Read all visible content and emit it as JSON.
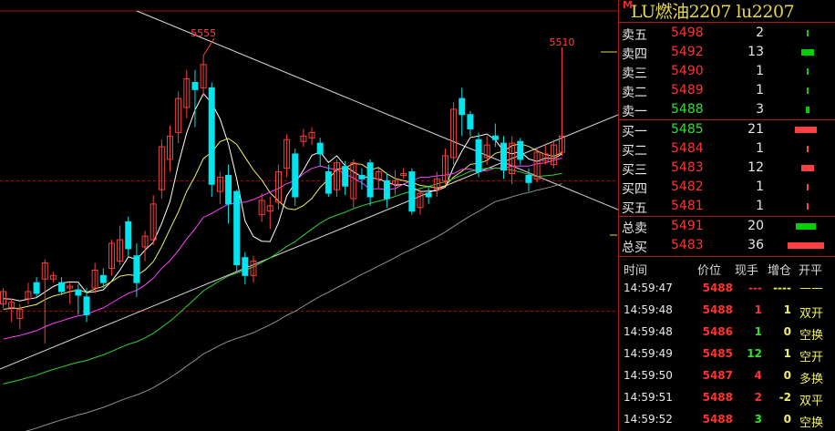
{
  "chart_data": {
    "type": "candlestick",
    "ylim": [
      5345,
      5580
    ],
    "reference_lines": [
      5485,
      5412
    ],
    "high_label": "5555",
    "high_marker_value": 5555,
    "last_label": "5510",
    "last_marker_value": 5510,
    "candles": [
      {
        "o": 5416,
        "c": 5423,
        "h": 5425,
        "l": 5414
      },
      {
        "o": 5414,
        "c": 5417,
        "h": 5419,
        "l": 5406
      },
      {
        "o": 5408,
        "c": 5413,
        "h": 5416,
        "l": 5402
      },
      {
        "o": 5419,
        "c": 5423,
        "h": 5428,
        "l": 5416
      },
      {
        "o": 5428,
        "c": 5422,
        "h": 5431,
        "l": 5420
      },
      {
        "o": 5430,
        "c": 5439,
        "h": 5441,
        "l": 5394
      },
      {
        "o": 5430,
        "c": 5432,
        "h": 5434,
        "l": 5428
      },
      {
        "o": 5428,
        "c": 5423,
        "h": 5431,
        "l": 5421
      },
      {
        "o": 5425,
        "c": 5426,
        "h": 5428,
        "l": 5416
      },
      {
        "o": 5424,
        "c": 5421,
        "h": 5427,
        "l": 5410
      },
      {
        "o": 5420,
        "c": 5410,
        "h": 5425,
        "l": 5406
      },
      {
        "o": 5425,
        "c": 5435,
        "h": 5439,
        "l": 5422
      },
      {
        "o": 5432,
        "c": 5428,
        "h": 5436,
        "l": 5425
      },
      {
        "o": 5436,
        "c": 5450,
        "h": 5452,
        "l": 5432
      },
      {
        "o": 5440,
        "c": 5452,
        "h": 5460,
        "l": 5438
      },
      {
        "o": 5462,
        "c": 5447,
        "h": 5465,
        "l": 5443
      },
      {
        "o": 5443,
        "c": 5428,
        "h": 5450,
        "l": 5420
      },
      {
        "o": 5448,
        "c": 5454,
        "h": 5457,
        "l": 5440
      },
      {
        "o": 5452,
        "c": 5472,
        "h": 5477,
        "l": 5449
      },
      {
        "o": 5480,
        "c": 5504,
        "h": 5508,
        "l": 5475
      },
      {
        "o": 5497,
        "c": 5510,
        "h": 5516,
        "l": 5490
      },
      {
        "o": 5512,
        "c": 5531,
        "h": 5535,
        "l": 5506
      },
      {
        "o": 5526,
        "c": 5542,
        "h": 5547,
        "l": 5520
      },
      {
        "o": 5540,
        "c": 5536,
        "h": 5547,
        "l": 5515
      },
      {
        "o": 5537,
        "c": 5550,
        "h": 5555,
        "l": 5532
      },
      {
        "o": 5537,
        "c": 5483,
        "h": 5540,
        "l": 5476
      },
      {
        "o": 5479,
        "c": 5487,
        "h": 5490,
        "l": 5472
      },
      {
        "o": 5488,
        "c": 5472,
        "h": 5494,
        "l": 5461
      },
      {
        "o": 5479,
        "c": 5438,
        "h": 5480,
        "l": 5434
      },
      {
        "o": 5442,
        "c": 5432,
        "h": 5445,
        "l": 5427
      },
      {
        "o": 5432,
        "c": 5440,
        "h": 5443,
        "l": 5428
      },
      {
        "o": 5466,
        "c": 5474,
        "h": 5478,
        "l": 5462
      },
      {
        "o": 5468,
        "c": 5471,
        "h": 5476,
        "l": 5458
      },
      {
        "o": 5473,
        "c": 5490,
        "h": 5494,
        "l": 5469
      },
      {
        "o": 5492,
        "c": 5508,
        "h": 5511,
        "l": 5487
      },
      {
        "o": 5500,
        "c": 5476,
        "h": 5503,
        "l": 5471
      },
      {
        "o": 5507,
        "c": 5510,
        "h": 5514,
        "l": 5504
      },
      {
        "o": 5509,
        "c": 5512,
        "h": 5515,
        "l": 5505
      },
      {
        "o": 5506,
        "c": 5500,
        "h": 5509,
        "l": 5493
      },
      {
        "o": 5490,
        "c": 5478,
        "h": 5494,
        "l": 5476
      },
      {
        "o": 5480,
        "c": 5495,
        "h": 5497,
        "l": 5476
      },
      {
        "o": 5493,
        "c": 5482,
        "h": 5496,
        "l": 5477
      },
      {
        "o": 5475,
        "c": 5495,
        "h": 5497,
        "l": 5470
      },
      {
        "o": 5488,
        "c": 5486,
        "h": 5492,
        "l": 5480
      },
      {
        "o": 5495,
        "c": 5476,
        "h": 5497,
        "l": 5471
      },
      {
        "o": 5486,
        "c": 5490,
        "h": 5492,
        "l": 5481
      },
      {
        "o": 5485,
        "c": 5475,
        "h": 5489,
        "l": 5470
      },
      {
        "o": 5483,
        "c": 5485,
        "h": 5491,
        "l": 5477
      },
      {
        "o": 5488,
        "c": 5489,
        "h": 5492,
        "l": 5486
      },
      {
        "o": 5490,
        "c": 5468,
        "h": 5492,
        "l": 5466
      },
      {
        "o": 5470,
        "c": 5478,
        "h": 5480,
        "l": 5466
      },
      {
        "o": 5478,
        "c": 5476,
        "h": 5482,
        "l": 5472
      },
      {
        "o": 5480,
        "c": 5486,
        "h": 5490,
        "l": 5476
      },
      {
        "o": 5485,
        "c": 5499,
        "h": 5503,
        "l": 5483
      },
      {
        "o": 5498,
        "c": 5525,
        "h": 5529,
        "l": 5494
      },
      {
        "o": 5531,
        "c": 5522,
        "h": 5537,
        "l": 5510
      },
      {
        "o": 5522,
        "c": 5514,
        "h": 5524,
        "l": 5510
      },
      {
        "o": 5508,
        "c": 5490,
        "h": 5512,
        "l": 5487
      },
      {
        "o": 5498,
        "c": 5505,
        "h": 5510,
        "l": 5494
      },
      {
        "o": 5510,
        "c": 5508,
        "h": 5517,
        "l": 5504
      },
      {
        "o": 5506,
        "c": 5491,
        "h": 5510,
        "l": 5486
      },
      {
        "o": 5489,
        "c": 5506,
        "h": 5510,
        "l": 5483
      },
      {
        "o": 5507,
        "c": 5497,
        "h": 5509,
        "l": 5494
      },
      {
        "o": 5488,
        "c": 5484,
        "h": 5492,
        "l": 5479
      },
      {
        "o": 5486,
        "c": 5501,
        "h": 5503,
        "l": 5484
      },
      {
        "o": 5496,
        "c": 5500,
        "h": 5505,
        "l": 5494
      },
      {
        "o": 5494,
        "c": 5505,
        "h": 5508,
        "l": 5492
      },
      {
        "o": 5501,
        "c": 5510,
        "h": 5540,
        "l": 5499
      }
    ]
  },
  "colors": {
    "up": "#ff3c3c",
    "down": "#00e5ee",
    "grid_red": "#9a1010",
    "trend": "#d8d8d8",
    "ma5": "#ffffff",
    "ma10": "#f0f060",
    "ma20": "#ff40ff",
    "ma40": "#30d030",
    "ma60": "#909090",
    "sell_bar": "#00d000",
    "buy_bar": "#ff4040"
  },
  "panel": {
    "marker": "M",
    "title": "LU燃油2207  lu2207",
    "asks": [
      {
        "label": "卖五",
        "price": "5498",
        "price_color": "#ff3232",
        "vol": "2",
        "bar": 2
      },
      {
        "label": "卖四",
        "price": "5492",
        "price_color": "#ff3232",
        "vol": "13",
        "bar": 13
      },
      {
        "label": "卖三",
        "price": "5490",
        "price_color": "#ff3232",
        "vol": "1",
        "bar": 1
      },
      {
        "label": "卖二",
        "price": "5489",
        "price_color": "#ff3232",
        "vol": "1",
        "bar": 1
      },
      {
        "label": "卖一",
        "price": "5488",
        "price_color": "#30e030",
        "vol": "3",
        "bar": 3
      }
    ],
    "bids": [
      {
        "label": "买一",
        "price": "5485",
        "price_color": "#30e030",
        "vol": "21",
        "bar": 21
      },
      {
        "label": "买二",
        "price": "5484",
        "price_color": "#ff3232",
        "vol": "1",
        "bar": 1
      },
      {
        "label": "买三",
        "price": "5483",
        "price_color": "#ff3232",
        "vol": "12",
        "bar": 12
      },
      {
        "label": "买四",
        "price": "5482",
        "price_color": "#ff3232",
        "vol": "1",
        "bar": 1
      },
      {
        "label": "买五",
        "price": "5481",
        "price_color": "#ff3232",
        "vol": "1",
        "bar": 1
      }
    ],
    "totals": [
      {
        "label": "总卖",
        "price": "5491",
        "price_color": "#ff3232",
        "vol": "20",
        "bar": 20,
        "bar_color": "#00d000"
      },
      {
        "label": "总买",
        "price": "5483",
        "price_color": "#ff3232",
        "vol": "36",
        "bar": 36,
        "bar_color": "#ff4040"
      }
    ],
    "tick_headers": {
      "time": "时间",
      "price": "价位",
      "qty": "现手",
      "oi": "增仓",
      "type": "开平"
    },
    "ticks": [
      {
        "time": "14:59:47",
        "price": "5488",
        "qty": "---",
        "qty_color": "#ff3232",
        "oi": "----",
        "type": "——"
      },
      {
        "time": "14:59:48",
        "price": "5488",
        "qty": "1",
        "qty_color": "#ff3232",
        "oi": "1",
        "type": "双开"
      },
      {
        "time": "14:59:48",
        "price": "5486",
        "qty": "1",
        "qty_color": "#30e030",
        "oi": "0",
        "type": "空换"
      },
      {
        "time": "14:59:49",
        "price": "5485",
        "qty": "12",
        "qty_color": "#30e030",
        "oi": "1",
        "type": "空开"
      },
      {
        "time": "14:59:50",
        "price": "5487",
        "qty": "4",
        "qty_color": "#ff3232",
        "oi": "0",
        "type": "多换"
      },
      {
        "time": "14:59:51",
        "price": "5488",
        "qty": "2",
        "qty_color": "#ff3232",
        "oi": "-2",
        "type": "双平"
      },
      {
        "time": "14:59:52",
        "price": "5488",
        "qty": "3",
        "qty_color": "#30e030",
        "oi": "0",
        "type": "空换"
      }
    ]
  }
}
